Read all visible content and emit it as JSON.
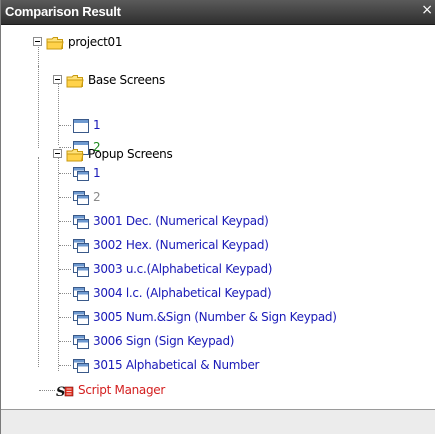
{
  "panel": {
    "title": "Comparison Result",
    "close_glyph": "×"
  },
  "tree": {
    "root": {
      "label": "project01",
      "icon": "folder-icon",
      "color": "#000000"
    },
    "base_screens": {
      "label": "Base Screens",
      "icon": "folder-icon",
      "color": "#000000",
      "items": [
        {
          "label": "1",
          "color": "#1a1ab8",
          "icon": "screen-icon"
        },
        {
          "label": "2",
          "color": "#1e8a1e",
          "icon": "screen-icon"
        }
      ]
    },
    "popup_screens": {
      "label": "Popup Screens",
      "icon": "folder-icon",
      "color": "#000000",
      "items": [
        {
          "label": "1",
          "color": "#1a1ab8",
          "icon": "popup-screen-icon"
        },
        {
          "label": "2",
          "color": "#8a8a8a",
          "icon": "popup-screen-icon"
        },
        {
          "label": "3001 Dec. (Numerical Keypad)",
          "color": "#1a1ab8",
          "icon": "popup-screen-icon"
        },
        {
          "label": "3002 Hex. (Numerical Keypad)",
          "color": "#1a1ab8",
          "icon": "popup-screen-icon"
        },
        {
          "label": "3003 u.c.(Alphabetical Keypad)",
          "color": "#1a1ab8",
          "icon": "popup-screen-icon"
        },
        {
          "label": "3004 l.c. (Alphabetical Keypad)",
          "color": "#1a1ab8",
          "icon": "popup-screen-icon"
        },
        {
          "label": "3005 Num.&Sign (Number & Sign Keypad)",
          "color": "#1a1ab8",
          "icon": "popup-screen-icon"
        },
        {
          "label": "3006 Sign (Sign Keypad)",
          "color": "#1a1ab8",
          "icon": "popup-screen-icon"
        },
        {
          "label": "3015 Alphabetical & Number",
          "color": "#1a1ab8",
          "icon": "popup-screen-icon"
        }
      ]
    },
    "script_manager": {
      "label": "Script Manager",
      "color": "#d42020",
      "icon": "script-manager-icon"
    }
  }
}
